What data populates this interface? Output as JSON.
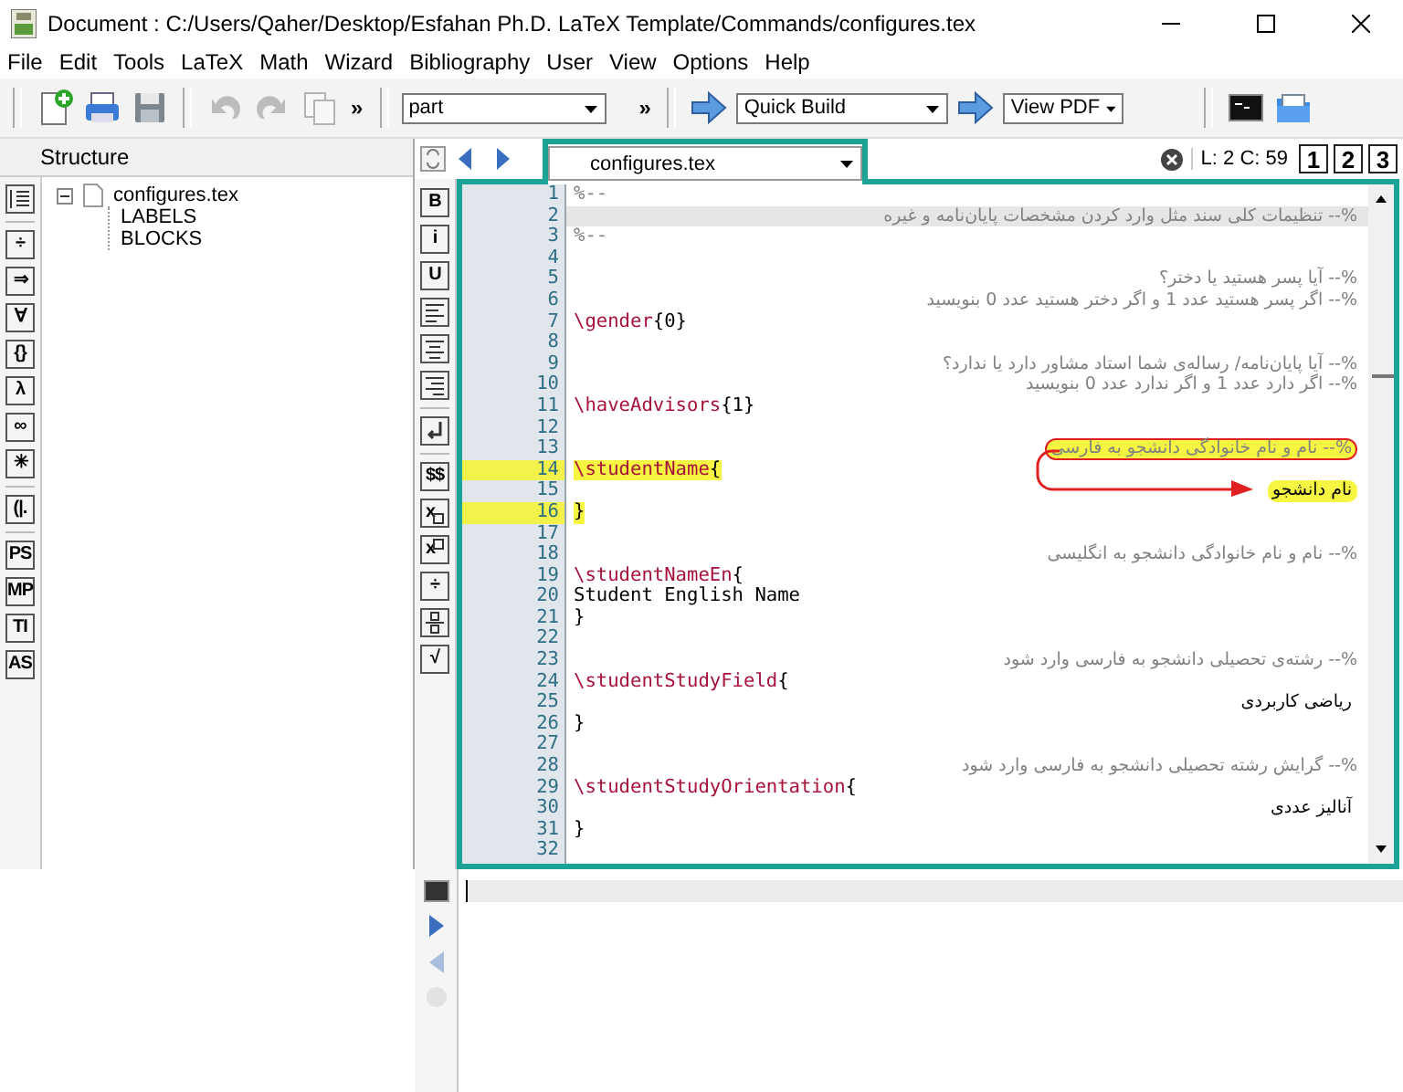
{
  "window": {
    "title": "Document : C:/Users/Qaher/Desktop/Esfahan Ph.D. LaTeX Template/Commands/configures.tex"
  },
  "menu": [
    "File",
    "Edit",
    "Tools",
    "LaTeX",
    "Math",
    "Wizard",
    "Bibliography",
    "User",
    "View",
    "Options",
    "Help"
  ],
  "toolbar": {
    "buttons": [
      {
        "kind": "new",
        "disabled": false
      },
      {
        "kind": "print",
        "disabled": false
      },
      {
        "kind": "save",
        "disabled": false
      },
      {
        "kind": "undo",
        "disabled": true
      },
      {
        "kind": "redo",
        "disabled": true
      },
      {
        "kind": "copy",
        "disabled": true
      }
    ],
    "more": "»",
    "part_combo": "part",
    "more2": "»",
    "build_combo": "Quick Build",
    "view_combo": "View PDF"
  },
  "structure": {
    "title": "Structure",
    "tree": [
      {
        "label": "configures.tex",
        "expanded": true,
        "children": [
          {
            "label": "LABELS"
          },
          {
            "label": "BLOCKS"
          }
        ]
      }
    ]
  },
  "left_tools": [
    {
      "kind": "list"
    },
    {
      "kind": "separator"
    },
    {
      "kind": "glyph",
      "label": "÷"
    },
    {
      "kind": "glyph",
      "label": "⇒"
    },
    {
      "kind": "glyph",
      "label": "∀"
    },
    {
      "kind": "glyph",
      "label": "{}"
    },
    {
      "kind": "glyph",
      "label": "λ"
    },
    {
      "kind": "glyph",
      "label": "∞"
    },
    {
      "kind": "glyph",
      "label": "✳"
    },
    {
      "kind": "separator"
    },
    {
      "kind": "glyph",
      "label": "(|."
    },
    {
      "kind": "separator"
    },
    {
      "kind": "glyph",
      "label": "PS"
    },
    {
      "kind": "glyph",
      "label": "MP"
    },
    {
      "kind": "glyph",
      "label": "TI"
    },
    {
      "kind": "glyph",
      "label": "AS"
    }
  ],
  "symbol_tools": [
    {
      "kind": "glyph",
      "label": "B"
    },
    {
      "kind": "glyph",
      "label": "i"
    },
    {
      "kind": "glyph",
      "label": "U"
    },
    {
      "kind": "align-left"
    },
    {
      "kind": "align-center"
    },
    {
      "kind": "align-right"
    },
    {
      "kind": "separator"
    },
    {
      "kind": "enter"
    },
    {
      "kind": "separator"
    },
    {
      "kind": "glyph",
      "label": "$$"
    },
    {
      "kind": "sub",
      "label": "x"
    },
    {
      "kind": "sup",
      "label": "x"
    },
    {
      "kind": "glyph",
      "label": "÷"
    },
    {
      "kind": "fraction"
    },
    {
      "kind": "glyph",
      "label": "√"
    }
  ],
  "editor": {
    "tab": "configures.tex",
    "position": "L: 2 C: 59",
    "bookmarks": [
      "1",
      "2",
      "3"
    ],
    "lines": [
      {
        "number": "1",
        "kind": "comment",
        "text": "%--",
        "current": false,
        "marked": false,
        "highlighted": false,
        "circled": false
      },
      {
        "number": "2",
        "kind": "rtl-comment",
        "text": "%-- تنظیمات کلی سند مثل وارد کردن مشخصات پایان‌نامه و غیره",
        "current": true,
        "marked": false,
        "highlighted": false,
        "circled": false
      },
      {
        "number": "3",
        "kind": "comment",
        "text": "%--",
        "current": false,
        "marked": false,
        "highlighted": false,
        "circled": false
      },
      {
        "number": "4",
        "kind": "blank",
        "current": false,
        "marked": false,
        "highlighted": false,
        "circled": false
      },
      {
        "number": "5",
        "kind": "rtl-comment",
        "text": "%-- آیا پسر هستید یا دختر؟",
        "current": false,
        "marked": false,
        "highlighted": false,
        "circled": false
      },
      {
        "number": "6",
        "kind": "rtl-comment",
        "text": "%-- اگر پسر هستید عدد 1 و اگر دختر هستید عدد 0 بنویسید",
        "current": false,
        "marked": false,
        "highlighted": false,
        "circled": false
      },
      {
        "number": "7",
        "kind": "command",
        "text": "\\gender",
        "arg": "{0}",
        "current": false,
        "marked": false,
        "highlighted": false,
        "circled": false
      },
      {
        "number": "8",
        "kind": "blank",
        "current": false,
        "marked": false,
        "highlighted": false,
        "circled": false
      },
      {
        "number": "9",
        "kind": "rtl-comment",
        "text": "%-- آیا پایان‌نامه/ رساله‌ی شما استاد مشاور دارد یا ندارد؟",
        "current": false,
        "marked": false,
        "highlighted": false,
        "circled": false
      },
      {
        "number": "10",
        "kind": "rtl-comment",
        "text": "%-- اگر دارد عدد 1 و اگر ندارد عدد 0 بنویسید",
        "current": false,
        "marked": false,
        "highlighted": false,
        "circled": false
      },
      {
        "number": "11",
        "kind": "command",
        "text": "\\haveAdvisors",
        "arg": "{1}",
        "current": false,
        "marked": false,
        "highlighted": false,
        "circled": false
      },
      {
        "number": "12",
        "kind": "blank",
        "current": false,
        "marked": false,
        "highlighted": false,
        "circled": false
      },
      {
        "number": "13",
        "kind": "rtl-comment",
        "text": "%-- نام و نام خانوادگی دانشجو به فارسی",
        "current": false,
        "marked": false,
        "highlighted": true,
        "circled": true
      },
      {
        "number": "14",
        "kind": "command",
        "text": "\\studentName",
        "arg": "{",
        "current": false,
        "marked": true,
        "highlighted": true,
        "circled": false
      },
      {
        "number": "15",
        "kind": "rtl-text",
        "text": "نام دانشجو",
        "current": false,
        "marked": false,
        "highlighted": true,
        "circled": false
      },
      {
        "number": "16",
        "kind": "text",
        "text": "}",
        "current": false,
        "marked": true,
        "highlighted": true,
        "circled": false
      },
      {
        "number": "17",
        "kind": "blank",
        "current": false,
        "marked": false,
        "highlighted": false,
        "circled": false
      },
      {
        "number": "18",
        "kind": "rtl-comment",
        "text": "%-- نام و نام خانوادگی دانشجو به انگلیسی",
        "current": false,
        "marked": false,
        "highlighted": false,
        "circled": false
      },
      {
        "number": "19",
        "kind": "command",
        "text": "\\studentNameEn",
        "arg": "{",
        "current": false,
        "marked": false,
        "highlighted": false,
        "circled": false
      },
      {
        "number": "20",
        "kind": "text",
        "text": "Student English Name",
        "current": false,
        "marked": false,
        "highlighted": false,
        "circled": false
      },
      {
        "number": "21",
        "kind": "text",
        "text": "}",
        "current": false,
        "marked": false,
        "highlighted": false,
        "circled": false
      },
      {
        "number": "22",
        "kind": "blank",
        "current": false,
        "marked": false,
        "highlighted": false,
        "circled": false
      },
      {
        "number": "23",
        "kind": "rtl-comment",
        "text": "%-- رشته‌ی تحصیلی دانشجو به فارسی وارد شود",
        "current": false,
        "marked": false,
        "highlighted": false,
        "circled": false
      },
      {
        "number": "24",
        "kind": "command",
        "text": "\\studentStudyField",
        "arg": "{",
        "current": false,
        "marked": false,
        "highlighted": false,
        "circled": false
      },
      {
        "number": "25",
        "kind": "rtl-text",
        "text": "ریاضی کاربردی",
        "current": false,
        "marked": false,
        "highlighted": false,
        "circled": false
      },
      {
        "number": "26",
        "kind": "text",
        "text": "}",
        "current": false,
        "marked": false,
        "highlighted": false,
        "circled": false
      },
      {
        "number": "27",
        "kind": "blank",
        "current": false,
        "marked": false,
        "highlighted": false,
        "circled": false
      },
      {
        "number": "28",
        "kind": "rtl-comment",
        "text": "%-- گرایش رشته تحصیلی دانشجو به فارسی وارد شود",
        "current": false,
        "marked": false,
        "highlighted": false,
        "circled": false
      },
      {
        "number": "29",
        "kind": "command",
        "text": "\\studentStudyOrientation",
        "arg": "{",
        "current": false,
        "marked": false,
        "highlighted": false,
        "circled": false
      },
      {
        "number": "30",
        "kind": "rtl-text",
        "text": "آنالیز عددی",
        "current": false,
        "marked": false,
        "highlighted": false,
        "circled": false
      },
      {
        "number": "31",
        "kind": "text",
        "text": "}",
        "current": false,
        "marked": false,
        "highlighted": false,
        "circled": false
      },
      {
        "number": "32",
        "kind": "blank",
        "current": false,
        "marked": false,
        "highlighted": false,
        "circled": false
      }
    ]
  }
}
